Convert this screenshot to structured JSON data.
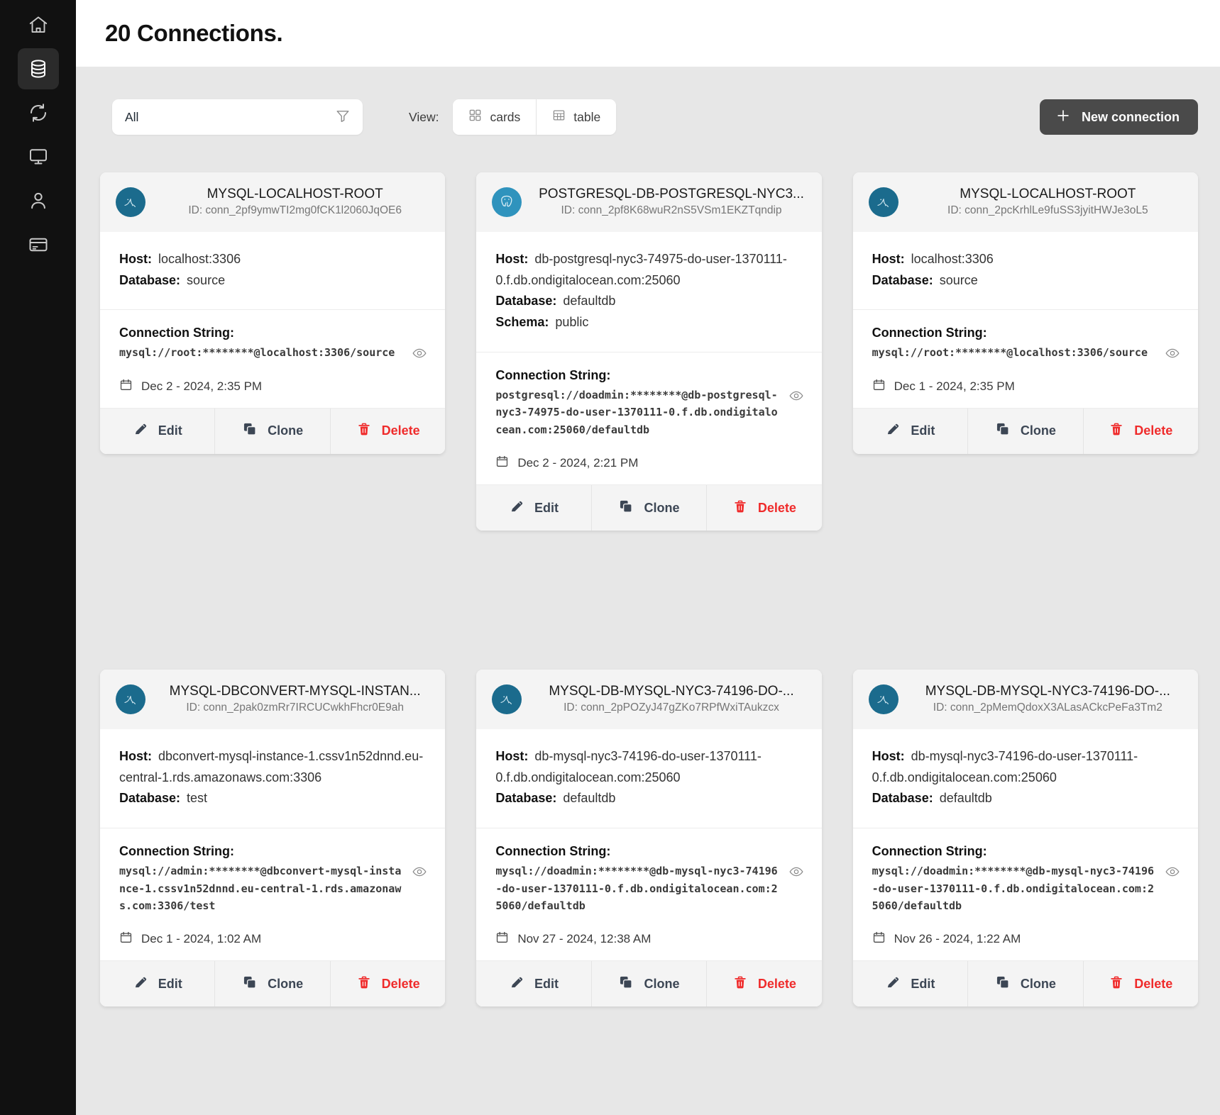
{
  "sidebar": {
    "items": [
      {
        "name": "home-icon",
        "label": "Home",
        "active": false
      },
      {
        "name": "database-icon",
        "label": "Connections",
        "active": true
      },
      {
        "name": "sync-icon",
        "label": "Streams",
        "active": false
      },
      {
        "name": "monitor-icon",
        "label": "Monitor",
        "active": false
      },
      {
        "name": "user-icon",
        "label": "Account",
        "active": false
      },
      {
        "name": "credit-card-icon",
        "label": "Billing",
        "active": false
      }
    ]
  },
  "header": {
    "title": "20 Connections."
  },
  "toolbar": {
    "filter_value": "All",
    "filter_icon": "filter-icon",
    "view_label": "View:",
    "view_options": [
      {
        "label": "cards",
        "icon": "grid-icon",
        "selected": true
      },
      {
        "label": "table",
        "icon": "table-icon",
        "selected": false
      }
    ],
    "new_connection_label": "New connection",
    "new_connection_icon": "plus-icon"
  },
  "labels": {
    "host": "Host:",
    "database": "Database:",
    "schema": "Schema:",
    "connection_string": "Connection String:",
    "id_prefix": "ID:",
    "edit": "Edit",
    "clone": "Clone",
    "delete": "Delete",
    "calendar_icon": "calendar-icon",
    "eye_icon": "eye-icon",
    "edit_icon": "pencil-icon",
    "clone_icon": "copy-icon",
    "delete_icon": "trash-icon"
  },
  "colors": {
    "sidebar_bg": "#111111",
    "page_bg": "#e7e7e7",
    "card_bg": "#ffffff",
    "card_head_bg": "#f4f4f4",
    "mysql_avatar": "#1b6b8d",
    "postgres_avatar": "#2f93bd",
    "danger": "#ef2b2b",
    "button_dark": "#4a4a4a"
  },
  "cards": [
    {
      "engine": "mysql",
      "title": "MYSQL-LOCALHOST-ROOT",
      "id": "ID: conn_2pf9ymwTI2mg0fCK1l2060JqOE6",
      "host": "localhost:3306",
      "database": "source",
      "schema": null,
      "connection_string": "mysql://root:********@localhost:3306/source",
      "date": "Dec 2 - 2024, 2:35 PM"
    },
    {
      "engine": "postgres",
      "title": "POSTGRESQL-DB-POSTGRESQL-NYC3...",
      "id": "ID: conn_2pf8K68wuR2nS5VSm1EKZTqndip",
      "host": "db-postgresql-nyc3-74975-do-user-1370111-0.f.db.ondigitalocean.com:25060",
      "database": "defaultdb",
      "schema": "public",
      "connection_string": "postgresql://doadmin:********@db-postgresql-nyc3-74975-do-user-1370111-0.f.db.ondigitalocean.com:25060/defaultdb",
      "date": "Dec 2 - 2024, 2:21 PM"
    },
    {
      "engine": "mysql",
      "title": "MYSQL-LOCALHOST-ROOT",
      "id": "ID: conn_2pcKrhlLe9fuSS3jyitHWJe3oL5",
      "host": "localhost:3306",
      "database": "source",
      "schema": null,
      "connection_string": "mysql://root:********@localhost:3306/source",
      "date": "Dec 1 - 2024, 2:35 PM"
    },
    {
      "engine": "mysql",
      "title": "MYSQL-DBCONVERT-MYSQL-INSTAN...",
      "id": "ID: conn_2pak0zmRr7IRCUCwkhFhcr0E9ah",
      "host": "dbconvert-mysql-instance-1.cssv1n52dnnd.eu-central-1.rds.amazonaws.com:3306",
      "database": "test",
      "schema": null,
      "connection_string": "mysql://admin:********@dbconvert-mysql-instance-1.cssv1n52dnnd.eu-central-1.rds.amazonaws.com:3306/test",
      "date": "Dec 1 - 2024, 1:02 AM"
    },
    {
      "engine": "mysql",
      "title": "MYSQL-DB-MYSQL-NYC3-74196-DO-...",
      "id": "ID: conn_2pPOZyJ47gZKo7RPfWxiTAukzcx",
      "host": "db-mysql-nyc3-74196-do-user-1370111-0.f.db.ondigitalocean.com:25060",
      "database": "defaultdb",
      "schema": null,
      "connection_string": "mysql://doadmin:********@db-mysql-nyc3-74196-do-user-1370111-0.f.db.ondigitalocean.com:25060/defaultdb",
      "date": "Nov 27 - 2024, 12:38 AM"
    },
    {
      "engine": "mysql",
      "title": "MYSQL-DB-MYSQL-NYC3-74196-DO-...",
      "id": "ID: conn_2pMemQdoxX3ALasACkcPeFa3Tm2",
      "host": "db-mysql-nyc3-74196-do-user-1370111-0.f.db.ondigitalocean.com:25060",
      "database": "defaultdb",
      "schema": null,
      "connection_string": "mysql://doadmin:********@db-mysql-nyc3-74196-do-user-1370111-0.f.db.ondigitalocean.com:25060/defaultdb",
      "date": "Nov 26 - 2024, 1:22 AM"
    }
  ]
}
